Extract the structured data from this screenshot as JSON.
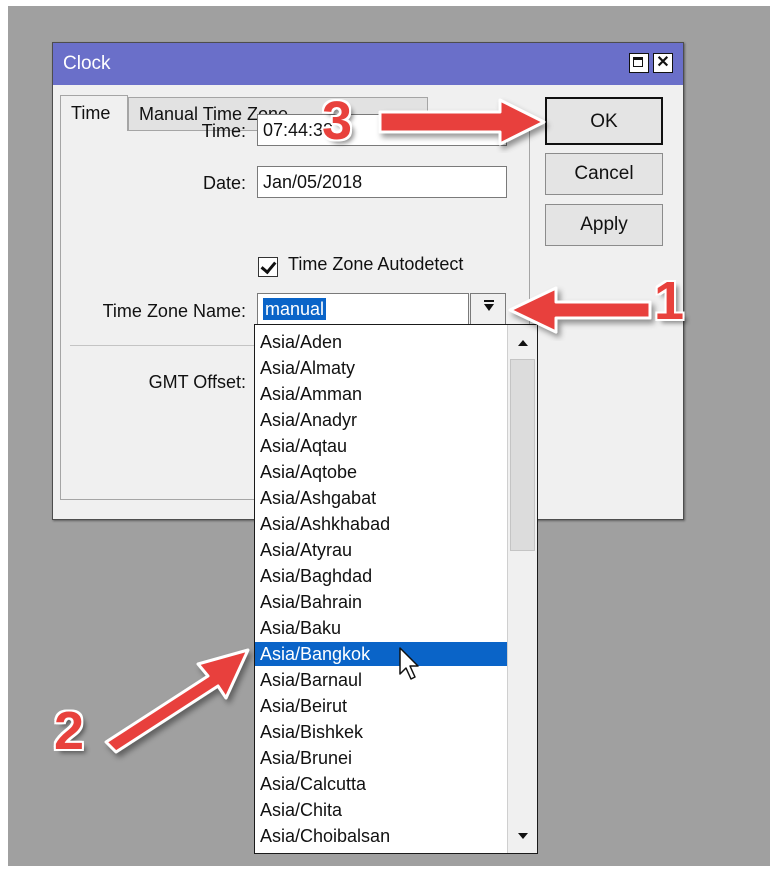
{
  "window": {
    "title": "Clock",
    "maximize_label": "",
    "close_label": "✕"
  },
  "tabs": [
    {
      "label": "Time",
      "active": true
    },
    {
      "label": "Manual Time Zone",
      "active": false
    }
  ],
  "form": {
    "time_label": "Time:",
    "time_value": "07:44:38",
    "date_label": "Date:",
    "date_value": "Jan/05/2018",
    "autodetect_label": "Time Zone Autodetect",
    "autodetect_checked": true,
    "tz_name_label": "Time Zone Name:",
    "tz_name_value": "manual",
    "gmt_offset_label": "GMT Offset:"
  },
  "buttons": {
    "ok": "OK",
    "cancel": "Cancel",
    "apply": "Apply"
  },
  "timezone_list": {
    "items": [
      "Asia/Aden",
      "Asia/Almaty",
      "Asia/Amman",
      "Asia/Anadyr",
      "Asia/Aqtau",
      "Asia/Aqtobe",
      "Asia/Ashgabat",
      "Asia/Ashkhabad",
      "Asia/Atyrau",
      "Asia/Baghdad",
      "Asia/Bahrain",
      "Asia/Baku",
      "Asia/Bangkok",
      "Asia/Barnaul",
      "Asia/Beirut",
      "Asia/Bishkek",
      "Asia/Brunei",
      "Asia/Calcutta",
      "Asia/Chita",
      "Asia/Choibalsan"
    ],
    "selected": "Asia/Bangkok"
  },
  "annotations": {
    "step1": "1",
    "step2": "2",
    "step3": "3",
    "arrow_color": "#e8413c"
  },
  "colors": {
    "titlebar": "#6a6fc9",
    "selection": "#0a64c8",
    "background": "#a0a0a0"
  }
}
